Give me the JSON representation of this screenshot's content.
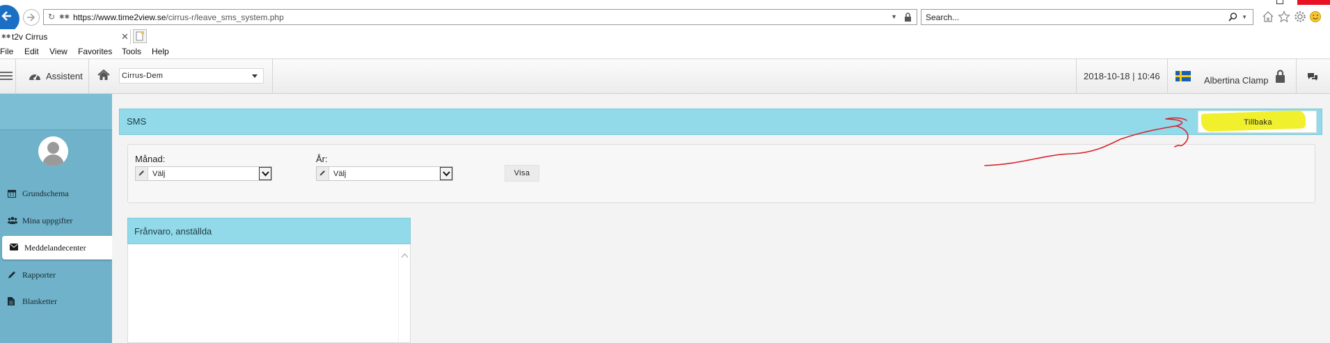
{
  "browser": {
    "url_prefix": "https://www.",
    "url_domain": "time2view.se",
    "url_path": "/cirrus-r/leave_sms_system.php",
    "search_placeholder": "Search...",
    "tab_title": "t2v Cirrus",
    "menu": [
      "File",
      "Edit",
      "View",
      "Favorites",
      "Tools",
      "Help"
    ]
  },
  "appbar": {
    "assistant_label": "Assistent",
    "company": "Cirrus-Dem",
    "datetime": "2018-10-18 | 10:46",
    "user_name": "Albertina Clamp"
  },
  "sidebar": {
    "items": [
      {
        "label": "Grundschema",
        "icon": "calendar-icon"
      },
      {
        "label": "Mina uppgifter",
        "icon": "users-icon"
      },
      {
        "label": "Meddelandecenter",
        "icon": "envelope-icon",
        "active": true
      },
      {
        "label": "Rapporter",
        "icon": "pencil-icon"
      },
      {
        "label": "Blanketter",
        "icon": "document-icon"
      }
    ]
  },
  "sms_panel": {
    "title": "SMS",
    "back_button": "Tillbaka"
  },
  "filter": {
    "month_label": "Månad:",
    "month_value": "Välj",
    "year_label": "År:",
    "year_value": "Välj",
    "show_button": "Visa"
  },
  "absence_panel": {
    "title": "Frånvaro, anställda"
  },
  "colors": {
    "panel_header": "#92dae9",
    "sidebar": "#6fb2c9",
    "highlight": "#f1f02c",
    "annotation": "#d9222a"
  }
}
